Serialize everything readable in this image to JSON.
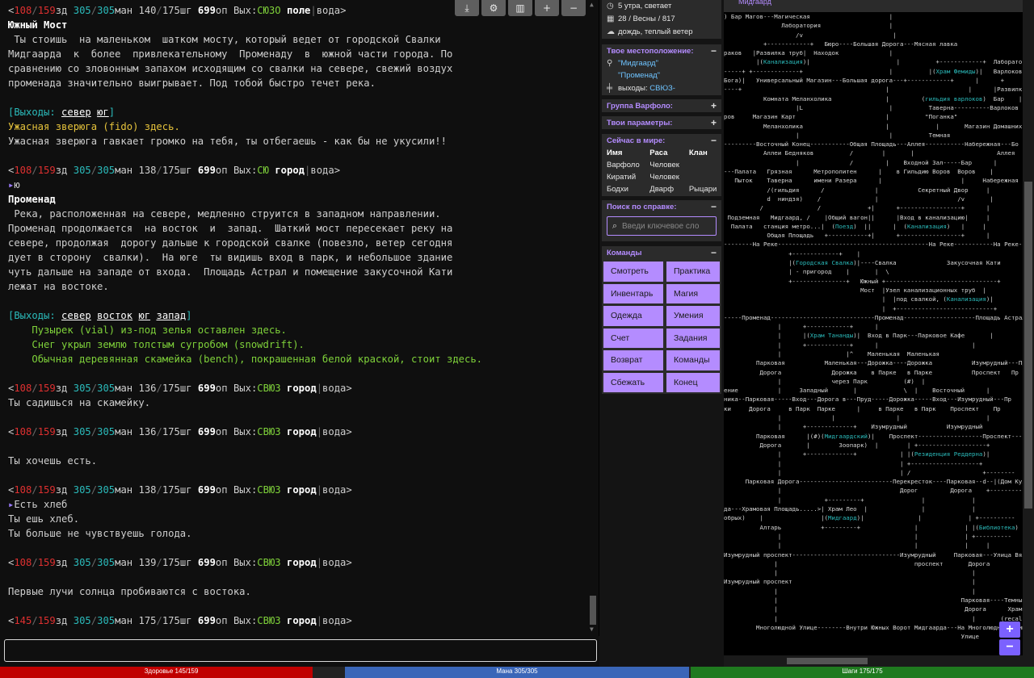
{
  "terminal": {
    "p1": {
      "hp": "108",
      "hpmax": "159",
      "zd": "зд",
      "mana": "305",
      "manamax": "305",
      "man": "ман",
      "mv": "140",
      "mvmax": "175",
      "sh": "шг",
      "exp": "699",
      "op": "оп",
      "exits_label": "Вых:",
      "exits": "СЮЗО",
      "terrain": "поле",
      "weather": "вода",
      "sep": "|",
      "close": ">"
    },
    "room1_name": "Южный Мост",
    "room1_desc": [
      " Ты стоишь  на маленьком  шатком мосту, который ведет от городской Свалки",
      "Мидгаарда  к  более  привлекательному  Променаду  в  южной части города. По",
      "сравнению со зловонным запахом исходящим со свалки на севере, свежий воздух",
      "променада значительно выигрывает. Под тобой быстро течет река."
    ],
    "room1_exits": {
      "open": "[Выходы: ",
      "north": "север",
      "south": "юг",
      "close": "]"
    },
    "fido_line": "Ужасная зверюга (fido) здесь.",
    "fido_bark": "Ужасная зверюга гавкает громко на тебя, ты отбегаешь - как бы не укусили!!",
    "p2": {
      "hp": "108",
      "hpmax": "159",
      "mana": "305",
      "manamax": "305",
      "mv": "138",
      "mvmax": "175",
      "exp": "699",
      "exits": "СЮ",
      "terrain": "город",
      "weather": "вода"
    },
    "cmd1": "ю",
    "room2_name": "Променад",
    "room2_desc": [
      " Река, расположенная на севере, медленно струится в западном направлении.",
      "Променад продолжается  на восток  и  запад.  Шаткий мост пересекает реку на",
      "севере, продолжая  дорогу дальше к городской свалке (повезло, ветер сегодня",
      "дует в сторону  свалки).  На юге  ты видишь вход в парк, и небольшое здание",
      "чуть дальше на западе от входа.  Площадь Астрал и помещение закусочной Кати",
      "лежат на востоке."
    ],
    "room2_exits": {
      "open": "[Выходы: ",
      "north": "север",
      "east": "восток",
      "south": "юг",
      "west": "запад",
      "close": "]"
    },
    "objects": [
      "Пузырек (vial) из-под зелья оставлен здесь.",
      "Снег укрыл землю толстым сугробом (snowdrift).",
      "Обычная деревянная скамейка (bench), покрашенная белой краской, стоит здесь."
    ],
    "p3": {
      "hp": "108",
      "hpmax": "159",
      "mana": "305",
      "manamax": "305",
      "mv": "136",
      "mvmax": "175",
      "exp": "699",
      "exits": "СВЮЗ",
      "terrain": "город",
      "weather": "вода"
    },
    "sit_msg": "Ты садишься на скамейку.",
    "p4": {
      "hp": "108",
      "hpmax": "159",
      "mana": "305",
      "manamax": "305",
      "mv": "136",
      "mvmax": "175",
      "exp": "699",
      "exits": "СВЮЗ",
      "terrain": "город",
      "weather": "вода"
    },
    "hungry_msg": "Ты хочешь есть.",
    "p5": {
      "hp": "108",
      "hpmax": "159",
      "mana": "305",
      "manamax": "305",
      "mv": "138",
      "mvmax": "175",
      "exp": "699",
      "exits": "СВЮЗ",
      "terrain": "город",
      "weather": "вода"
    },
    "cmd2": "Есть хлеб",
    "eat_msg": "Ты ешь хлеб.",
    "full_msg": "Ты больше не чувствуешь голода.",
    "p6": {
      "hp": "108",
      "hpmax": "159",
      "mana": "305",
      "manamax": "305",
      "mv": "139",
      "mvmax": "175",
      "exp": "699",
      "exits": "СВЮЗ",
      "terrain": "город",
      "weather": "вода"
    },
    "sunrise_msg": "Первые лучи солнца пробиваются с востока.",
    "p7": {
      "hp": "145",
      "hpmax": "159",
      "mana": "305",
      "manamax": "305",
      "mv": "175",
      "mvmax": "175",
      "exp": "699",
      "exits": "СВЮЗ",
      "terrain": "город",
      "weather": "вода"
    }
  },
  "toolbar_icons": [
    "download-icon",
    "gear-icon",
    "map-icon",
    "plus-icon",
    "minus-icon"
  ],
  "toolbar_glyphs": {
    "download": "⤓",
    "gear": "⚙",
    "map": "▥",
    "plus": "+",
    "minus": "−"
  },
  "sidebar": {
    "time": "5 утра, светает",
    "date": "28 / Весны / 817",
    "weather": "дождь, теплый ветер",
    "location_title": "Твое местоположение:",
    "area": "\"Мидгаард\"",
    "room": "\"Променад\"",
    "exits_label": "выходы:",
    "exits_value": "СВЮЗ-",
    "group_title": "Группа Варфоло:",
    "params_title": "Твои параметры:",
    "who_title": "Сейчас в мире:",
    "who_headers": [
      "Имя",
      "Раса",
      "Клан"
    ],
    "who_rows": [
      [
        "Варфоло",
        "Человек",
        ""
      ],
      [
        "Киратий",
        "Человек",
        ""
      ],
      [
        "Бодхи",
        "Дварф",
        "Рыцари"
      ]
    ],
    "help_title": "Поиск по справке:",
    "help_placeholder": "Введи ключевое сло",
    "commands_title": "Команды",
    "commands": [
      "Смотреть",
      "Практика",
      "Инвентарь",
      "Магия",
      "Одежда",
      "Умения",
      "Счет",
      "Задания",
      "Возврат",
      "Команды",
      "Сбежать",
      "Конец"
    ],
    "collapse": "−",
    "expand": "+"
  },
  "map": {
    "title": "Мидгаард",
    "lines": [
      ") Бар Магов---Магическая                      |                                    (гильд",
      "                Лаборатория                   |",
      "                    /v                         |",
      "           +------------+   Бюро----Большая Дорога---Мясная лавка",
      "раков   |Развилка труб|  Находок              |",
      "         |(Канализация)|                        |          +------------+  Лаборатория",
      "-----+ +-------------+                        |          |(Храм Фемиды)|   Варлоков  \\v",
      "Бога)|   Универсальный Магазин---Большая дорога---+------------+      |      +",
      "----+                                        |                      |      |Развилк",
      "           Комната Меланхолика               |         (гильдия варлоков)  Бар    |(Кан",
      "                    |L                        |          Таверна----------Варлоков  +-----",
      "ров     Магазин Карт                         |          \"Поганка\"",
      "           Меланхолика                       |             |       Магазин Домашних Живот",
      "                    |                         |          Темная",
      "---------Восточный Конец-----------Общая Площадь---Аллея-----------Набережная---Бо",
      "           Аллеи Бедняков          /        |       |                       Аллея",
      "                    |              /         |    Входной Зал-----Бар      |",
      "---Палата   Грязная      Метрополитен      |    в Гильдию Воров  Воров    |",
      "   Пыток    Таверна      имени Разера      |                      |     Набережная",
      "            /(гильдия      /              |           Секретный Двор     |",
      "            d  ниндзя)    /               |                      /v       |",
      "          /               /             +|      +-----------------+      |",
      " Подземная   Мидгаард, /    |Общий вагон||      |Вход в канализацию|     |",
      "  Палата   станция метро...|  (Поезд)  ||      |  (Канализация)   |     |",
      "            Общая Площадь   +-----------+|      +-----------------+      |",
      "--------На Реке------------------------------------------На Реке-----------На Реке-------",
      "                  +-------------+    |",
      "                  |(Городская Свалка)|----Свалка              Закусочная Кати",
      "                  | - пригород    |       |  \\",
      "                  +---------------+   Южный +-------------------------------+",
      "                                      Мост  |Узел канализационных труб  |",
      "                                            |  |под свалкой, (Канализация)|",
      "                                            |  +---------------------------+",
      "-----Променад-----------------------------Променад--------------------Площадь Астрал--",
      "               |      +------------+      |",
      "               |      |(Храм Тананды)|  Вход в Парк---Парковое Кафе       |",
      "               |      +------------+      |                          |",
      "               |                  |^    Маленькая  Маленькая",
      "         Парковая           Маленькая---Дорожка----Дорожка           Изумрудный---Пр",
      "          Дорога              Дорожка    в Парке   в Парке           Проспект   Пр",
      "               |              через Парк          (#)  |",
      "ение           |     Западный       |             \\  |    Восточный      |",
      "ника--Парковая-----Вход---Дорога в---Пруд-----Дорожка-----Вход---Изумрудный---Пр",
      "ки     Дорога     в Парк  Парке      |     в Парке   в Парк    Проспект    Пр",
      "               |              |                 |                        |",
      "               |      +-------------+    Изумрудный           Изумрудный",
      "         Парковая      |(#)(Мидгаардский)|    Проспект------------------Проспект------",
      "          Дорога       |        Зоопарк)  |        | +-------------------+",
      "               |      +-------------+            | |(Резиденция Реддерна)|",
      "               |                                 | +-------------------+",
      "               |                                 | /                    +--------",
      "      Парковая Дорога--------------------------Перекресток----Парковая--d--|(Дом Кузне",
      "               |                                 Дорог         Дорога    +----------",
      "               |            +---------+                |             |",
      "да---Храмовая Площадь.....>| Храм Лео  |               |             |",
      "обрых)    |                |(Мидгаард)|               |             | +----------",
      "          Алтарь           +---------+               |             | |(Библиотека)",
      "               |                                     |             | +----------",
      "               |                                     |             |     |",
      "Изумрудный проспект------------------------------Изумрудный     Парковая---Улица Вязов",
      "              |                                      проспект       Дорога",
      "              |                                                      |",
      "Изумрудный проспект                                                  |",
      "              |                                                      |",
      "              |                                                   Парковая----Темный-----",
      "              |                                                    Дорога      Храм",
      "              |                                                      |       (recal",
      "         Многолюдной Улице--------Внутри Южных Ворот Мидгаарда---На Многолюдной Улице",
      "                                                                  Улице"
    ],
    "zoom_in": "+",
    "zoom_out": "−"
  },
  "bars": {
    "hp_label": "Здоровье 145/159",
    "hp_fraction": 0.912,
    "hp_color": "#c00000",
    "mana_label": "Мана 305/305",
    "mana_fraction": 1.0,
    "mana_color": "#3a66b8",
    "moves_label": "Шаги 175/175",
    "moves_fraction": 1.0,
    "moves_color": "#1f7a1f"
  }
}
